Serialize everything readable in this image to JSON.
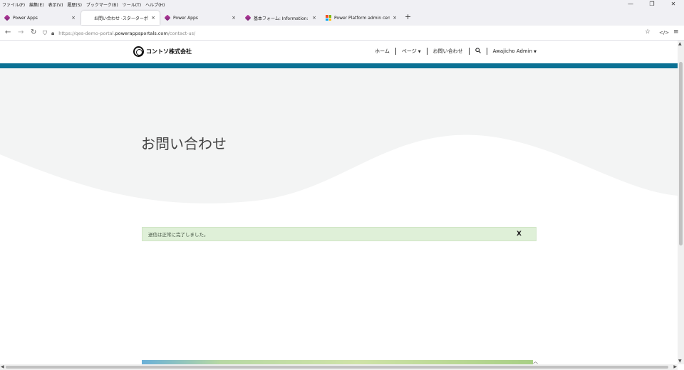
{
  "menubar": {
    "items": [
      "ファイル(F)",
      "編集(E)",
      "表示(V)",
      "履歴(S)",
      "ブックマーク(B)",
      "ツール(T)",
      "ヘルプ(H)"
    ]
  },
  "window_controls": {
    "minimize": "—",
    "restore": "❐",
    "close": "✕"
  },
  "tabs": [
    {
      "label": "Power Apps",
      "icon": "power-apps-icon",
      "close": "×"
    },
    {
      "label": "お問い合わせ ·スターターポータル",
      "icon": "",
      "close": "×",
      "active": true
    },
    {
      "label": "Power Apps",
      "icon": "power-apps-icon",
      "close": "×"
    },
    {
      "label": "基本フォーム: Information: Contac",
      "icon": "power-apps-icon",
      "close": "×"
    },
    {
      "label": "Power Platform admin center",
      "icon": "microsoft-icon",
      "close": "×"
    }
  ],
  "new_tab": "+",
  "address": {
    "url_prefix": "https://qes-demo-portal.",
    "url_domain": "powerappsportals.com",
    "url_path": "/contact-us/"
  },
  "site": {
    "logo_text": "コントソ株式会社",
    "nav": {
      "home": "ホーム",
      "pages": "ページ",
      "contact": "お問い合わせ",
      "user": "Awajicho Admin"
    },
    "page_title": "お問い合わせ",
    "alert": {
      "message": "送信は正常に完了しました。",
      "close": "X"
    }
  },
  "colors": {
    "accent_teal": "#0b7194",
    "alert_bg": "#dff0d8",
    "hero_bg": "#f3f4f4"
  }
}
